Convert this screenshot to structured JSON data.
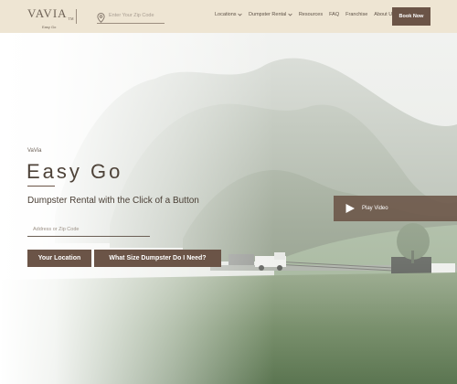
{
  "header": {
    "logo_text": "VAVIA",
    "logo_mark": "TM",
    "logo_sub": "Easy Go",
    "zip_placeholder": "Enter Your Zip Code",
    "nav": [
      {
        "label": "Locations",
        "dropdown": true
      },
      {
        "label": "Dumpster Rental",
        "dropdown": true
      },
      {
        "label": "Resources",
        "dropdown": false
      },
      {
        "label": "FAQ",
        "dropdown": false
      },
      {
        "label": "Franchise",
        "dropdown": false
      },
      {
        "label": "About Us",
        "dropdown": false
      }
    ],
    "book_now": "Book Now"
  },
  "hero": {
    "eyebrow": "VaVia",
    "title": "Easy Go",
    "subtitle": "Dumpster Rental with the Click of a Button",
    "address_placeholder": "Address or Zip Code",
    "btn_location": "Your Location",
    "btn_size": "What Size Dumpster Do I Need?",
    "play_video": "Play Video"
  },
  "icons": {
    "zip": "location-pin-icon",
    "nav_dropdown": "chevron-down-icon",
    "play": "play-icon"
  },
  "colors": {
    "header_bg": "#eee5d3",
    "brand_brown": "#6b5447",
    "text_dark": "#4e4339"
  }
}
